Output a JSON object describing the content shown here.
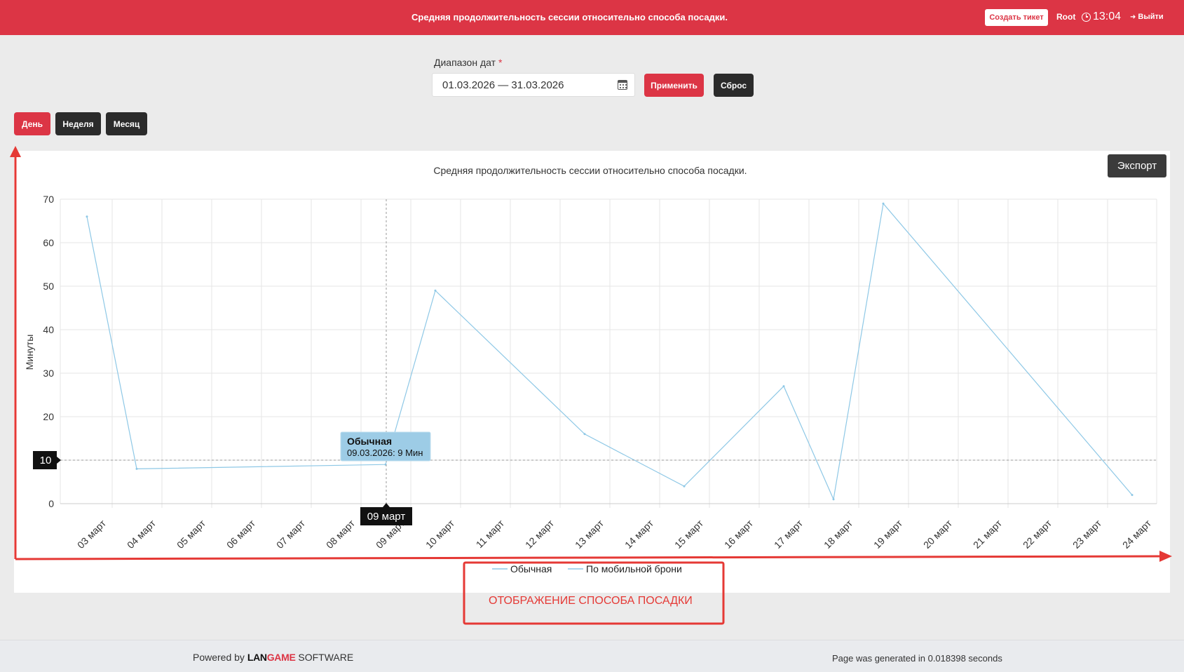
{
  "header": {
    "title": "Средняя продолжительность сессии относительно способа посадки.",
    "create_ticket": "Создать тикет",
    "user": "Root",
    "time": "13:04",
    "logout": "Выйти"
  },
  "filter": {
    "date_label": "Диапазон дат",
    "required_mark": "*",
    "date_range": "01.03.2026 — 31.03.2026",
    "apply": "Применить",
    "reset": "Сброс"
  },
  "period_buttons": {
    "day": "День",
    "week": "Неделя",
    "month": "Месяц",
    "active": "day"
  },
  "export_label": "Экспорт",
  "chart_data": {
    "type": "line",
    "title": "Средняя продолжительность сессии относительно способа посадки.",
    "ylabel": "Минуты",
    "xlabel": "",
    "ylim": [
      0,
      70
    ],
    "yticks": [
      0,
      10,
      20,
      30,
      40,
      50,
      60,
      70
    ],
    "grid": true,
    "categories": [
      "03 март",
      "04 март",
      "05 март",
      "06 март",
      "07 март",
      "08 март",
      "09 март",
      "10 март",
      "11 март",
      "12 март",
      "13 март",
      "14 март",
      "15 март",
      "16 март",
      "17 март",
      "18 март",
      "19 март",
      "20 март",
      "21 март",
      "22 март",
      "23 март",
      "24 март"
    ],
    "points": [
      {
        "x": "03 март",
        "y": 66
      },
      {
        "x": "04 март",
        "y": 8
      },
      {
        "x": "09 март",
        "y": 9
      },
      {
        "x": "10 март",
        "y": 49
      },
      {
        "x": "13 март",
        "y": 16
      },
      {
        "x": "15 март",
        "y": 4
      },
      {
        "x": "17 март",
        "y": 27
      },
      {
        "x": "18 март",
        "y": 1
      },
      {
        "x": "19 март",
        "y": 69
      },
      {
        "x": "24 март",
        "y": 2
      }
    ],
    "series": [
      {
        "name": "Обычная",
        "color": "#8ec8e6"
      },
      {
        "name": "По мобильной брони",
        "color": "#8ec8e6"
      }
    ],
    "legend_position": "bottom",
    "line_color": "#8ec8e6",
    "crosshair": {
      "x": "09 март",
      "y": 10,
      "x_label": "09 март",
      "y_label": "10"
    },
    "tooltip": {
      "title": "Обычная",
      "text": "09.03.2026: 9 Мин"
    }
  },
  "annotation": {
    "text": "ОТОБРАЖЕНИЕ СПОСОБА ПОСАДКИ",
    "color": "#e53935"
  },
  "footer": {
    "powered_prefix": "Powered by",
    "brand_lan": "LAN",
    "brand_game": "GAME",
    "brand_suffix": "SOFTWARE",
    "generated": "Page was generated in 0.018398 seconds"
  },
  "colors": {
    "accent": "#dc3545",
    "dark_button": "#2b2b2b",
    "page_bg": "#ebebeb"
  }
}
